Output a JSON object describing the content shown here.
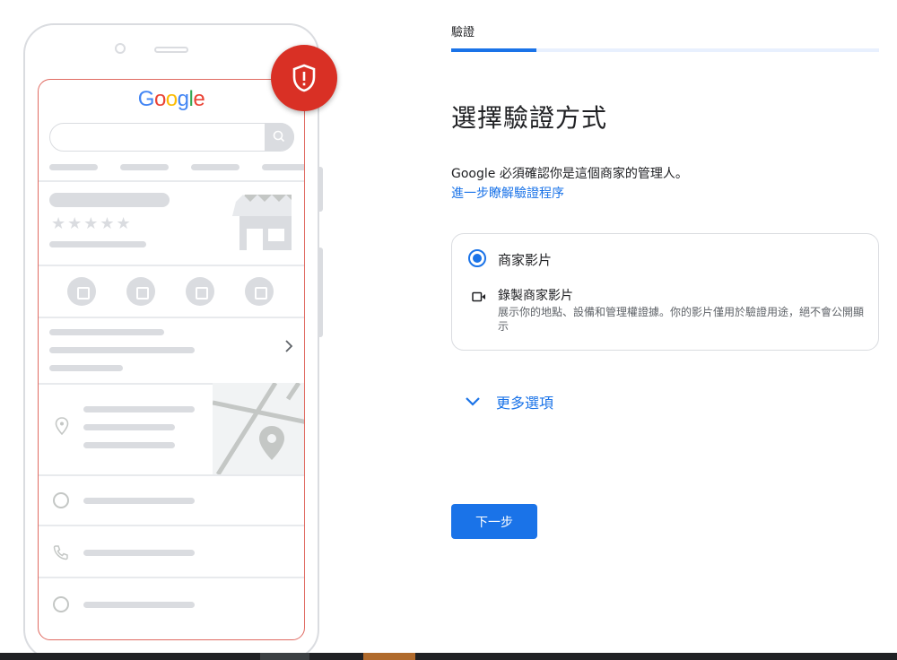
{
  "illustration": {
    "logo_text": "Google",
    "logo_colors": [
      "#4285F4",
      "#EA4335",
      "#FBBC05",
      "#4285F4",
      "#34A853",
      "#EA4335"
    ],
    "badge_icon": "shield-alert-icon",
    "badge_color": "#d93025"
  },
  "header": {
    "step_label": "驗證",
    "progress_fraction": 0.2
  },
  "main": {
    "title": "選擇驗證方式",
    "description": "Google 必須確認你是這個商家的管理人。",
    "learn_more_link": "進一步瞭解驗證程序",
    "option": {
      "label": "商家影片",
      "selected": true,
      "method_icon": "video-camera-icon",
      "method_title": "錄製商家影片",
      "method_description": "展示你的地點、設備和管理權證據。你的影片僅用於驗證用途，絕不會公開顯示"
    },
    "more_options_label": "更多選項",
    "next_button_label": "下一步"
  },
  "colors": {
    "accent": "#1a73e8",
    "text": "#202124",
    "secondary_text": "#5f6368",
    "border": "#dadce0"
  }
}
